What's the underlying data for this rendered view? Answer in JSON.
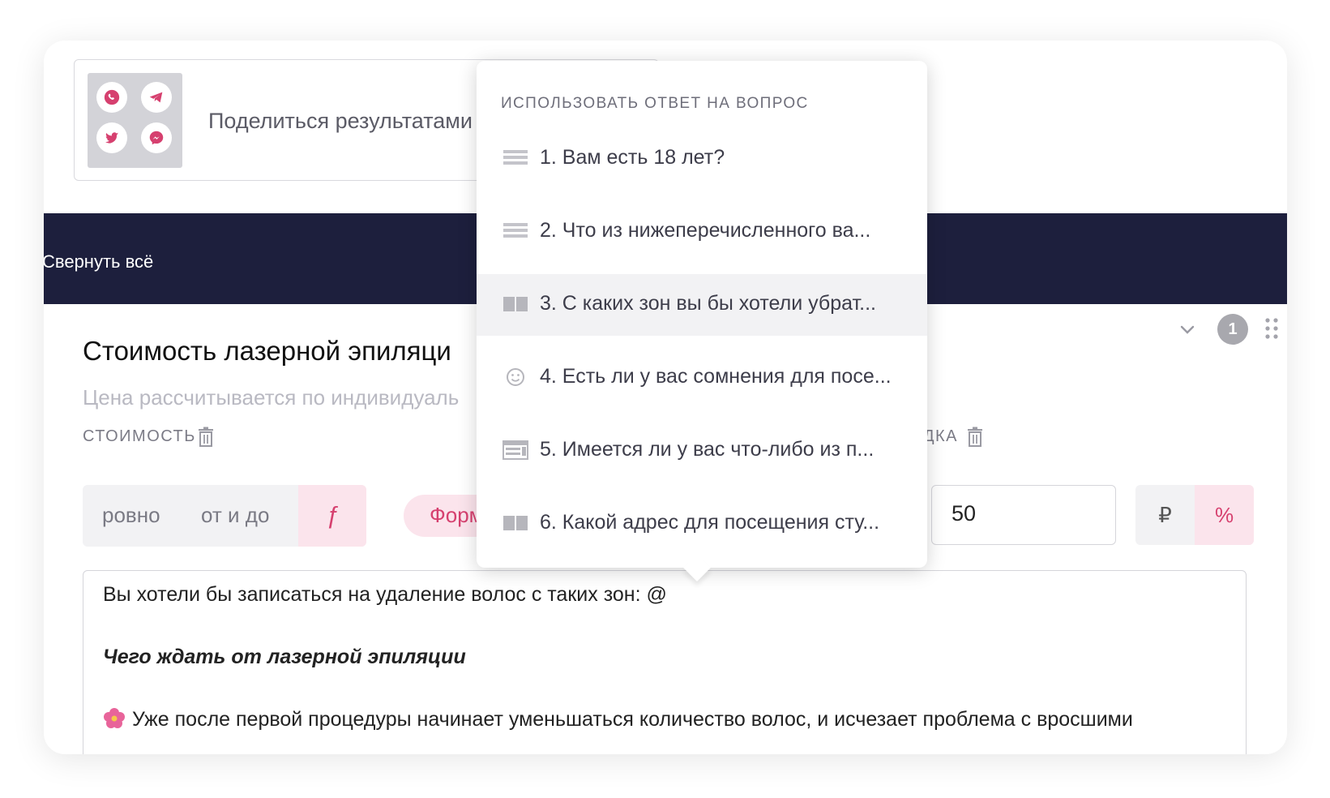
{
  "share": {
    "text": "Поделиться результатами",
    "icons": [
      "whatsapp-icon",
      "telegram-icon",
      "twitter-icon",
      "messenger-icon"
    ],
    "icon_color": "#d6406f"
  },
  "toolbar": {
    "collapse_all": "Свернуть всё"
  },
  "question": {
    "title": "Стоимость лазерной эпиляци",
    "subtitle": "Цена рассчитывается по индивидуаль",
    "number": "1"
  },
  "price": {
    "label": "СТОИМОСТЬ",
    "options": [
      "ровно",
      "от и до"
    ],
    "formula_symbol": "ƒ",
    "formula_button": "Форм"
  },
  "discount": {
    "label": "СКИДКА",
    "value": "50",
    "currency": "₽",
    "percent": "%"
  },
  "editor": {
    "line1": "Вы хотели бы записаться на удаление волос с таких зон: @",
    "line2": "Чего ждать от лазерной эпиляции",
    "line3": "Уже после первой процедуры начинает уменьшаться количество волос, и исчезает проблема с вросшими"
  },
  "dropdown": {
    "header": "ИСПОЛЬЗОВАТЬ ОТВЕТ НА ВОПРОС",
    "items": [
      {
        "label": "1. Вам есть 18 лет?",
        "icon": "list-icon"
      },
      {
        "label": "2. Что из нижеперечисленного ва...",
        "icon": "list-icon"
      },
      {
        "label": "3. С каких зон вы бы хотели убрат...",
        "icon": "image-choice-icon"
      },
      {
        "label": "4. Есть ли у вас сомнения для посе...",
        "icon": "smiley-icon"
      },
      {
        "label": "5. Имеется ли у вас что-либо из п...",
        "icon": "image-list-icon"
      },
      {
        "label": "6. Какой адрес для посещения сту...",
        "icon": "image-choice-icon"
      }
    ]
  },
  "colors": {
    "accent": "#d6406f",
    "accent_bg": "#fbe4ec",
    "dark_bar": "#1d1f3d"
  }
}
